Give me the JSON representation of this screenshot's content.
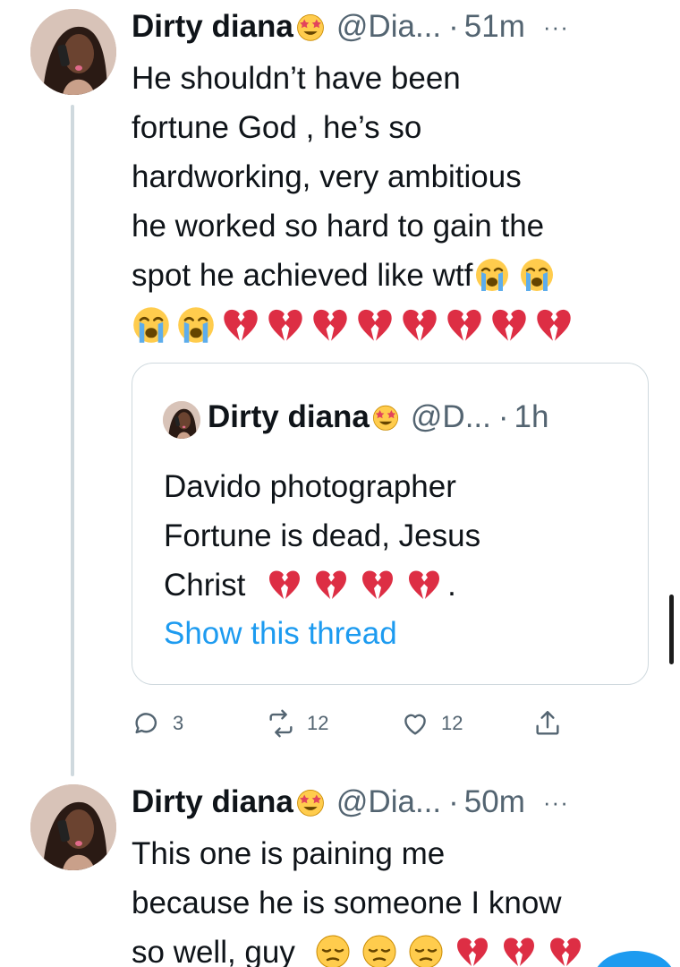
{
  "tweets": [
    {
      "name": "Dirty diana",
      "name_emoji": "star-struck-emoji",
      "handle": "@Dia...",
      "time": "51m",
      "more": "···",
      "text_lines": [
        "He shouldn’t have been",
        "fortune God , he’s so",
        "hardworking, very ambitious",
        "he worked so hard to gain the",
        "spot he achieved like wtf"
      ],
      "trailing_emojis_line5": [
        "loudly-crying-emoji",
        "loudly-crying-emoji"
      ],
      "emoji_row": [
        "loudly-crying-emoji",
        "loudly-crying-emoji",
        "broken-heart-emoji",
        "broken-heart-emoji",
        "broken-heart-emoji",
        "broken-heart-emoji",
        "broken-heart-emoji",
        "broken-heart-emoji",
        "broken-heart-emoji",
        "broken-heart-emoji"
      ],
      "quote": {
        "name": "Dirty diana",
        "name_emoji": "star-struck-emoji",
        "handle": "@D...",
        "time": "1h",
        "text_lines": [
          "Davido photographer",
          "Fortune is dead, Jesus",
          "Christ"
        ],
        "christ_emojis": [
          "broken-heart-emoji",
          "broken-heart-emoji",
          "broken-heart-emoji",
          "broken-heart-emoji"
        ],
        "christ_suffix": ".",
        "show_thread": "Show this thread"
      },
      "actions": {
        "reply_count": "3",
        "retweet_count": "12",
        "like_count": "12"
      }
    },
    {
      "name": "Dirty diana",
      "name_emoji": "star-struck-emoji",
      "handle": "@Dia...",
      "time": "50m",
      "more": "···",
      "text_lines": [
        "This one is paining me",
        "because he is someone I know",
        "so well, guy"
      ],
      "trailing_emojis_line3": [
        "pensive-face-emoji",
        "pensive-face-emoji",
        "pensive-face-emoji",
        "broken-heart-emoji",
        "broken-heart-emoji",
        "broken-heart-emoji"
      ]
    }
  ],
  "colors": {
    "text": "#0f1419",
    "secondary": "#536471",
    "link": "#1d9bf0",
    "border": "#cfd9de"
  }
}
